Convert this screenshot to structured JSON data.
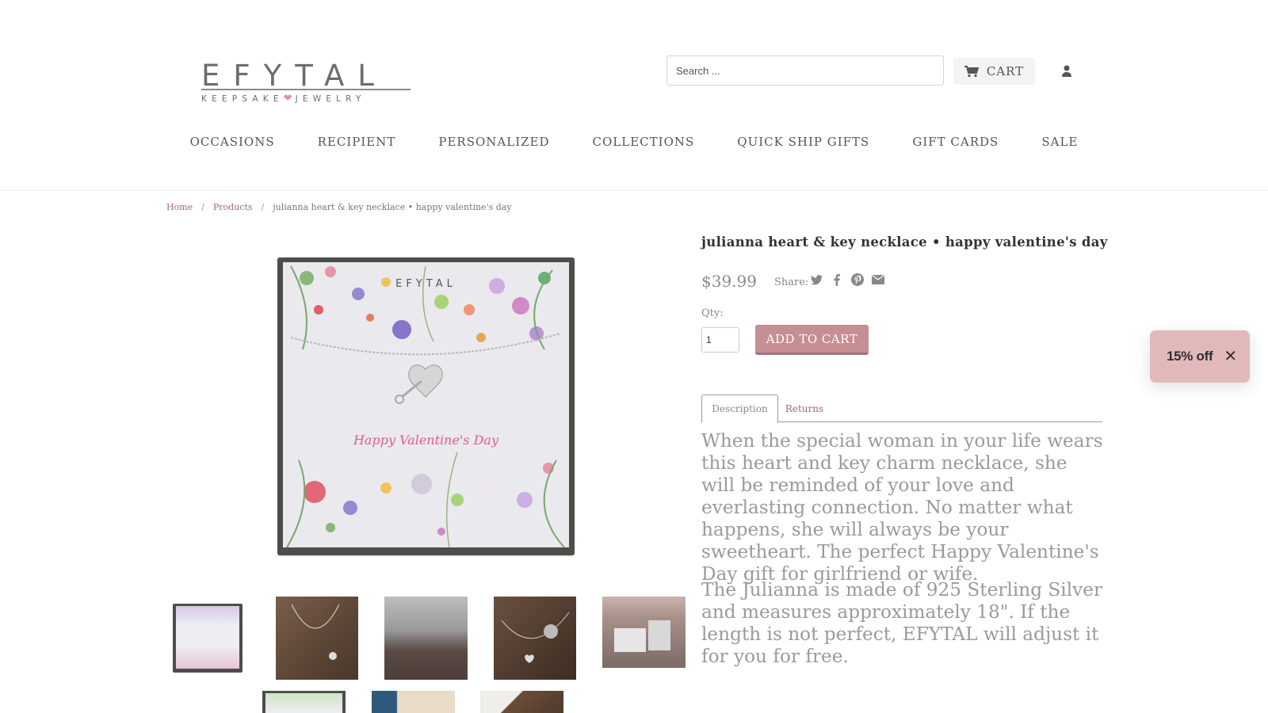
{
  "brand": {
    "logo_main": "EFYTAL",
    "logo_sub_left": "KEEPSAKE",
    "logo_sub_right": "JEWELRY"
  },
  "header": {
    "search_placeholder": "Search ...",
    "cart_label": "CART"
  },
  "nav": {
    "items": [
      "OCCASIONS",
      "RECIPIENT",
      "PERSONALIZED",
      "COLLECTIONS",
      "QUICK SHIP GIFTS",
      "GIFT CARDS",
      "SALE"
    ]
  },
  "breadcrumb": {
    "home": "Home",
    "products": "Products",
    "current": "julianna heart & key necklace • happy valentine's day",
    "separator": "/"
  },
  "product": {
    "title": "julianna heart & key necklace • happy valentine's day",
    "price": "$39.99",
    "share_label": "Share:",
    "share_icons": [
      "twitter-icon",
      "facebook-icon",
      "pinterest-icon",
      "email-icon"
    ],
    "qty_label": "Qty:",
    "qty_value": "1",
    "add_to_cart_label": "ADD TO CART",
    "image_card_brand": "EFYTAL",
    "image_card_text": "Happy Valentine's Day"
  },
  "tabs": {
    "description": "Description",
    "returns": "Returns"
  },
  "description": {
    "paragraph_1": "When the special woman in your life wears this heart and key charm necklace, she will be reminded of your love and everlasting connection. No matter what happens, she will always be your sweetheart. The perfect Happy Valentine's Day gift for girlfriend or wife.",
    "paragraph_2": "The Julianna is made of 925 Sterling Silver and measures approximately 18\". If the length is not perfect, EFYTAL will adjust it for you for free."
  },
  "discount_widget": {
    "label": "15% off",
    "close": "✕"
  },
  "colors": {
    "accent": "#c58e93",
    "link": "#a06a6f",
    "discount_bg": "#e2b9ba"
  }
}
